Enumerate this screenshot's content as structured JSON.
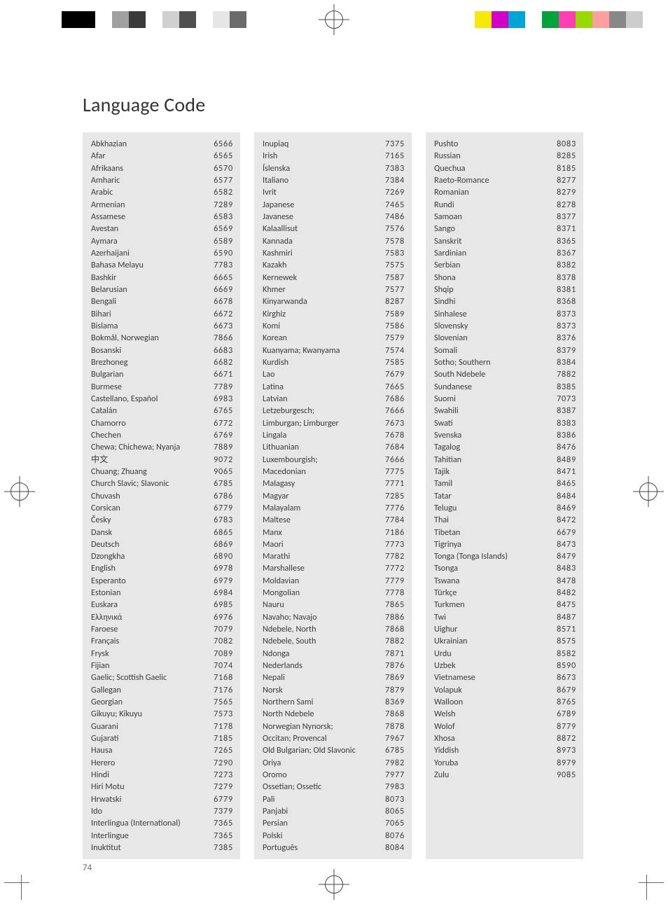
{
  "title": "Language Code",
  "page_number": "74",
  "color_bars_left": [
    "#000000",
    "#000000",
    "#ffffff",
    "#a0a0a0",
    "#3a3a3a",
    "#ffffff",
    "#d0d0d0",
    "#4f4f4f",
    "#ffffff",
    "#e6e6e6",
    "#6b6b6b"
  ],
  "color_bars_right": [
    "#f7ea00",
    "#d300c8",
    "#00a5d6",
    "#ffffff",
    "#00a33a",
    "#ff3fb1",
    "#9ad900",
    "#ff9f9f",
    "#888888",
    "#cccccc"
  ],
  "columns": [
    [
      {
        "lang": "Abkhazian",
        "code": "6566"
      },
      {
        "lang": "Afar",
        "code": "6565"
      },
      {
        "lang": "Afrikaans",
        "code": "6570"
      },
      {
        "lang": "Amharic",
        "code": "6577"
      },
      {
        "lang": "Arabic",
        "code": "6582"
      },
      {
        "lang": "Armenian",
        "code": "7289"
      },
      {
        "lang": "Assamese",
        "code": "6583"
      },
      {
        "lang": "Avestan",
        "code": "6569"
      },
      {
        "lang": "Aymara",
        "code": "6589"
      },
      {
        "lang": "Azerhaijani",
        "code": "6590"
      },
      {
        "lang": "Bahasa Melayu",
        "code": "7783"
      },
      {
        "lang": "Bashkir",
        "code": "6665"
      },
      {
        "lang": "Belarusian",
        "code": "6669"
      },
      {
        "lang": "Bengali",
        "code": "6678"
      },
      {
        "lang": "Bihari",
        "code": "6672"
      },
      {
        "lang": "Bislama",
        "code": "6673"
      },
      {
        "lang": "Bokmål, Norwegian",
        "code": "7866"
      },
      {
        "lang": "Bosanski",
        "code": "6683"
      },
      {
        "lang": "Brezhoneg",
        "code": "6682"
      },
      {
        "lang": "Bulgarian",
        "code": "6671"
      },
      {
        "lang": "Burmese",
        "code": "7789"
      },
      {
        "lang": "Castellano, Español",
        "code": "6983"
      },
      {
        "lang": "Catalán",
        "code": "6765"
      },
      {
        "lang": "Chamorro",
        "code": "6772"
      },
      {
        "lang": "Chechen",
        "code": "6769"
      },
      {
        "lang": "Chewa; Chichewa; Nyanja",
        "code": "7889"
      },
      {
        "lang": "中文",
        "code": "9072"
      },
      {
        "lang": "Chuang; Zhuang",
        "code": "9065"
      },
      {
        "lang": "Church Slavic; Slavonic",
        "code": "6785"
      },
      {
        "lang": "Chuvash",
        "code": "6786"
      },
      {
        "lang": "Corsican",
        "code": "6779"
      },
      {
        "lang": "Česky",
        "code": "6783"
      },
      {
        "lang": "Dansk",
        "code": "6865"
      },
      {
        "lang": "Deutsch",
        "code": "6869"
      },
      {
        "lang": "Dzongkha",
        "code": "6890"
      },
      {
        "lang": "English",
        "code": "6978"
      },
      {
        "lang": "Esperanto",
        "code": "6979"
      },
      {
        "lang": "Estonian",
        "code": "6984"
      },
      {
        "lang": "Euskara",
        "code": "6985"
      },
      {
        "lang": "Ελληνικά",
        "code": "6976"
      },
      {
        "lang": "Faroese",
        "code": "7079"
      },
      {
        "lang": "Français",
        "code": "7082"
      },
      {
        "lang": "Frysk",
        "code": "7089"
      },
      {
        "lang": "Fijian",
        "code": "7074"
      },
      {
        "lang": "Gaelic; Scottish Gaelic",
        "code": "7168"
      },
      {
        "lang": "Gallegan",
        "code": "7176"
      },
      {
        "lang": "Georgian",
        "code": "7565"
      },
      {
        "lang": "Gikuyu; Kikuyu",
        "code": "7573"
      },
      {
        "lang": "Guarani",
        "code": "7178"
      },
      {
        "lang": "Gujarati",
        "code": "7185"
      },
      {
        "lang": "Hausa",
        "code": "7265"
      },
      {
        "lang": "Herero",
        "code": "7290"
      },
      {
        "lang": "Hindi",
        "code": "7273"
      },
      {
        "lang": "Hiri Motu",
        "code": "7279"
      },
      {
        "lang": "Hrwatski",
        "code": "6779"
      },
      {
        "lang": "Ido",
        "code": "7379"
      },
      {
        "lang": "Interlingua (International)",
        "code": "7365"
      },
      {
        "lang": "Interlingue",
        "code": "7365"
      },
      {
        "lang": "Inuktitut",
        "code": "7385"
      }
    ],
    [
      {
        "lang": "Inupiaq",
        "code": "7375"
      },
      {
        "lang": "Irish",
        "code": "7165"
      },
      {
        "lang": "Íslenska",
        "code": "7383"
      },
      {
        "lang": "Italiano",
        "code": "7384"
      },
      {
        "lang": "Ivrit",
        "code": "7269"
      },
      {
        "lang": "Japanese",
        "code": "7465"
      },
      {
        "lang": "Javanese",
        "code": "7486"
      },
      {
        "lang": "Kalaallisut",
        "code": "7576"
      },
      {
        "lang": "Kannada",
        "code": "7578"
      },
      {
        "lang": "Kashmiri",
        "code": "7583"
      },
      {
        "lang": "Kazakh",
        "code": "7575"
      },
      {
        "lang": "Kernewek",
        "code": "7587"
      },
      {
        "lang": "Khmer",
        "code": "7577"
      },
      {
        "lang": "Kinyarwanda",
        "code": "8287"
      },
      {
        "lang": "Kirghiz",
        "code": "7589"
      },
      {
        "lang": "Komi",
        "code": "7586"
      },
      {
        "lang": "Korean",
        "code": "7579"
      },
      {
        "lang": "Kuanyama; Kwanyama",
        "code": "7574"
      },
      {
        "lang": "Kurdish",
        "code": "7585"
      },
      {
        "lang": "Lao",
        "code": "7679"
      },
      {
        "lang": "Latina",
        "code": "7665"
      },
      {
        "lang": "Latvian",
        "code": "7686"
      },
      {
        "lang": "Letzeburgesch;",
        "code": "7666"
      },
      {
        "lang": "Limburgan; Limburger",
        "code": "7673"
      },
      {
        "lang": "Lingala",
        "code": "7678"
      },
      {
        "lang": "Lithuanian",
        "code": "7684"
      },
      {
        "lang": "Luxembourgish;",
        "code": "7666"
      },
      {
        "lang": "Macedonian",
        "code": "7775"
      },
      {
        "lang": "Malagasy",
        "code": "7771"
      },
      {
        "lang": "Magyar",
        "code": "7285"
      },
      {
        "lang": "Malayalam",
        "code": "7776"
      },
      {
        "lang": "Maltese",
        "code": "7784"
      },
      {
        "lang": "Manx",
        "code": "7186"
      },
      {
        "lang": "Maori",
        "code": "7773"
      },
      {
        "lang": "Marathi",
        "code": "7782"
      },
      {
        "lang": "Marshallese",
        "code": "7772"
      },
      {
        "lang": "Moldavian",
        "code": "7779"
      },
      {
        "lang": "Mongolian",
        "code": "7778"
      },
      {
        "lang": "Nauru",
        "code": "7865"
      },
      {
        "lang": "Navaho; Navajo",
        "code": "7886"
      },
      {
        "lang": "Ndebele, North",
        "code": "7868"
      },
      {
        "lang": "Ndebele, South",
        "code": "7882"
      },
      {
        "lang": "Ndonga",
        "code": "7871"
      },
      {
        "lang": "Nederlands",
        "code": "7876"
      },
      {
        "lang": "Nepali",
        "code": "7869"
      },
      {
        "lang": "Norsk",
        "code": "7879"
      },
      {
        "lang": "Northern Sami",
        "code": "8369"
      },
      {
        "lang": "North Ndebele",
        "code": "7868"
      },
      {
        "lang": "Norwegian Nynorsk;",
        "code": "7878"
      },
      {
        "lang": "Occitan; Provencal",
        "code": "7967"
      },
      {
        "lang": "Old Bulgarian; Old Slavonic",
        "code": "6785"
      },
      {
        "lang": "Oriya",
        "code": "7982"
      },
      {
        "lang": "Oromo",
        "code": "7977"
      },
      {
        "lang": "Ossetian; Ossetic",
        "code": "7983"
      },
      {
        "lang": "Pali",
        "code": "8073"
      },
      {
        "lang": "Panjabi",
        "code": "8065"
      },
      {
        "lang": "Persian",
        "code": "7065"
      },
      {
        "lang": "Polski",
        "code": "8076"
      },
      {
        "lang": "Português",
        "code": "8084"
      }
    ],
    [
      {
        "lang": "Pushto",
        "code": "8083"
      },
      {
        "lang": "Russian",
        "code": "8285"
      },
      {
        "lang": "Quechua",
        "code": "8185"
      },
      {
        "lang": "Raeto-Romance",
        "code": "8277"
      },
      {
        "lang": "Romanian",
        "code": "8279"
      },
      {
        "lang": "Rundi",
        "code": "8278"
      },
      {
        "lang": "Samoan",
        "code": "8377"
      },
      {
        "lang": "Sango",
        "code": "8371"
      },
      {
        "lang": "Sanskrit",
        "code": "8365"
      },
      {
        "lang": "Sardinian",
        "code": "8367"
      },
      {
        "lang": "Serbian",
        "code": "8382"
      },
      {
        "lang": "Shona",
        "code": "8378"
      },
      {
        "lang": "Shqip",
        "code": "8381"
      },
      {
        "lang": "Sindhi",
        "code": "8368"
      },
      {
        "lang": "Sinhalese",
        "code": "8373"
      },
      {
        "lang": "Slovensky",
        "code": "8373"
      },
      {
        "lang": "Slovenian",
        "code": "8376"
      },
      {
        "lang": "Somali",
        "code": "8379"
      },
      {
        "lang": "Sotho; Southern",
        "code": "8384"
      },
      {
        "lang": "South Ndebele",
        "code": "7882"
      },
      {
        "lang": "Sundanese",
        "code": "8385"
      },
      {
        "lang": "Suomi",
        "code": "7073"
      },
      {
        "lang": "Swahili",
        "code": "8387"
      },
      {
        "lang": "Swati",
        "code": "8383"
      },
      {
        "lang": "Svenska",
        "code": "8386"
      },
      {
        "lang": "Tagalog",
        "code": "8476"
      },
      {
        "lang": "Tahitian",
        "code": "8489"
      },
      {
        "lang": "Tajik",
        "code": "8471"
      },
      {
        "lang": "Tamil",
        "code": "8465"
      },
      {
        "lang": "Tatar",
        "code": "8484"
      },
      {
        "lang": "Telugu",
        "code": "8469"
      },
      {
        "lang": "Thai",
        "code": "8472"
      },
      {
        "lang": "Tibetan",
        "code": "6679"
      },
      {
        "lang": "Tigrinya",
        "code": "8473"
      },
      {
        "lang": "Tonga (Tonga Islands)",
        "code": "8479"
      },
      {
        "lang": "Tsonga",
        "code": "8483"
      },
      {
        "lang": "Tswana",
        "code": "8478"
      },
      {
        "lang": "Türkçe",
        "code": "8482"
      },
      {
        "lang": "Turkmen",
        "code": "8475"
      },
      {
        "lang": "Twi",
        "code": "8487"
      },
      {
        "lang": "Uighur",
        "code": "8571"
      },
      {
        "lang": "Ukrainian",
        "code": "8575"
      },
      {
        "lang": "Urdu",
        "code": "8582"
      },
      {
        "lang": "Uzbek",
        "code": "8590"
      },
      {
        "lang": "Vietnamese",
        "code": "8673"
      },
      {
        "lang": "Volapuk",
        "code": "8679"
      },
      {
        "lang": "Walloon",
        "code": "8765"
      },
      {
        "lang": "Welsh",
        "code": "6789"
      },
      {
        "lang": "Wolof",
        "code": "8779"
      },
      {
        "lang": "Xhosa",
        "code": "8872"
      },
      {
        "lang": "Yiddish",
        "code": "8973"
      },
      {
        "lang": "Yoruba",
        "code": "8979"
      },
      {
        "lang": "Zulu",
        "code": "9085"
      }
    ]
  ]
}
